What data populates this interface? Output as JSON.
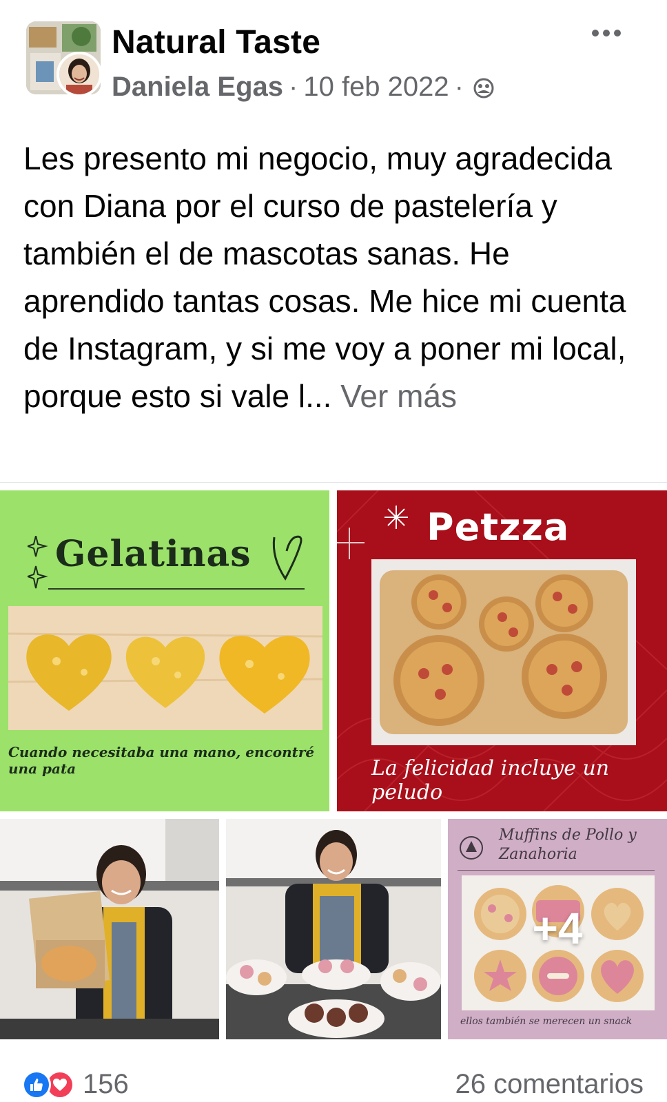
{
  "post": {
    "group_name": "Natural Taste",
    "author": "Daniela Egas",
    "separator": "·",
    "date": "10 feb 2022",
    "privacy_icon": "group-members-icon",
    "more_icon": "more-horizontal-icon",
    "text": "Les presento mi negocio, muy agradecida con Diana por el curso de pastelería y también el de mascotas sanas. He aprendido tantas cosas. Me hice mi cuenta de Instagram, y si me voy a poner mi local, porque esto si vale l...",
    "see_more": "Ver más"
  },
  "gallery": {
    "gelatinas": {
      "title": "Gelatinas",
      "caption": "Cuando necesitaba una mano, encontré una pata",
      "background": "#9be16a"
    },
    "petzza": {
      "title": "Petzza",
      "caption": "La felicidad incluye un peludo",
      "background": "#a80f1a"
    },
    "muffins": {
      "title": "Muffins de Pollo y Zanahoria",
      "caption": "ellos también se merecen un snack",
      "more_count": "+4",
      "background": "#c9a3bf"
    }
  },
  "footer": {
    "reaction_icons": [
      "like-icon",
      "love-icon"
    ],
    "reaction_count": "156",
    "comments": "26 comentarios",
    "like_color": "#1877f2",
    "love_color": "#f33e58"
  }
}
